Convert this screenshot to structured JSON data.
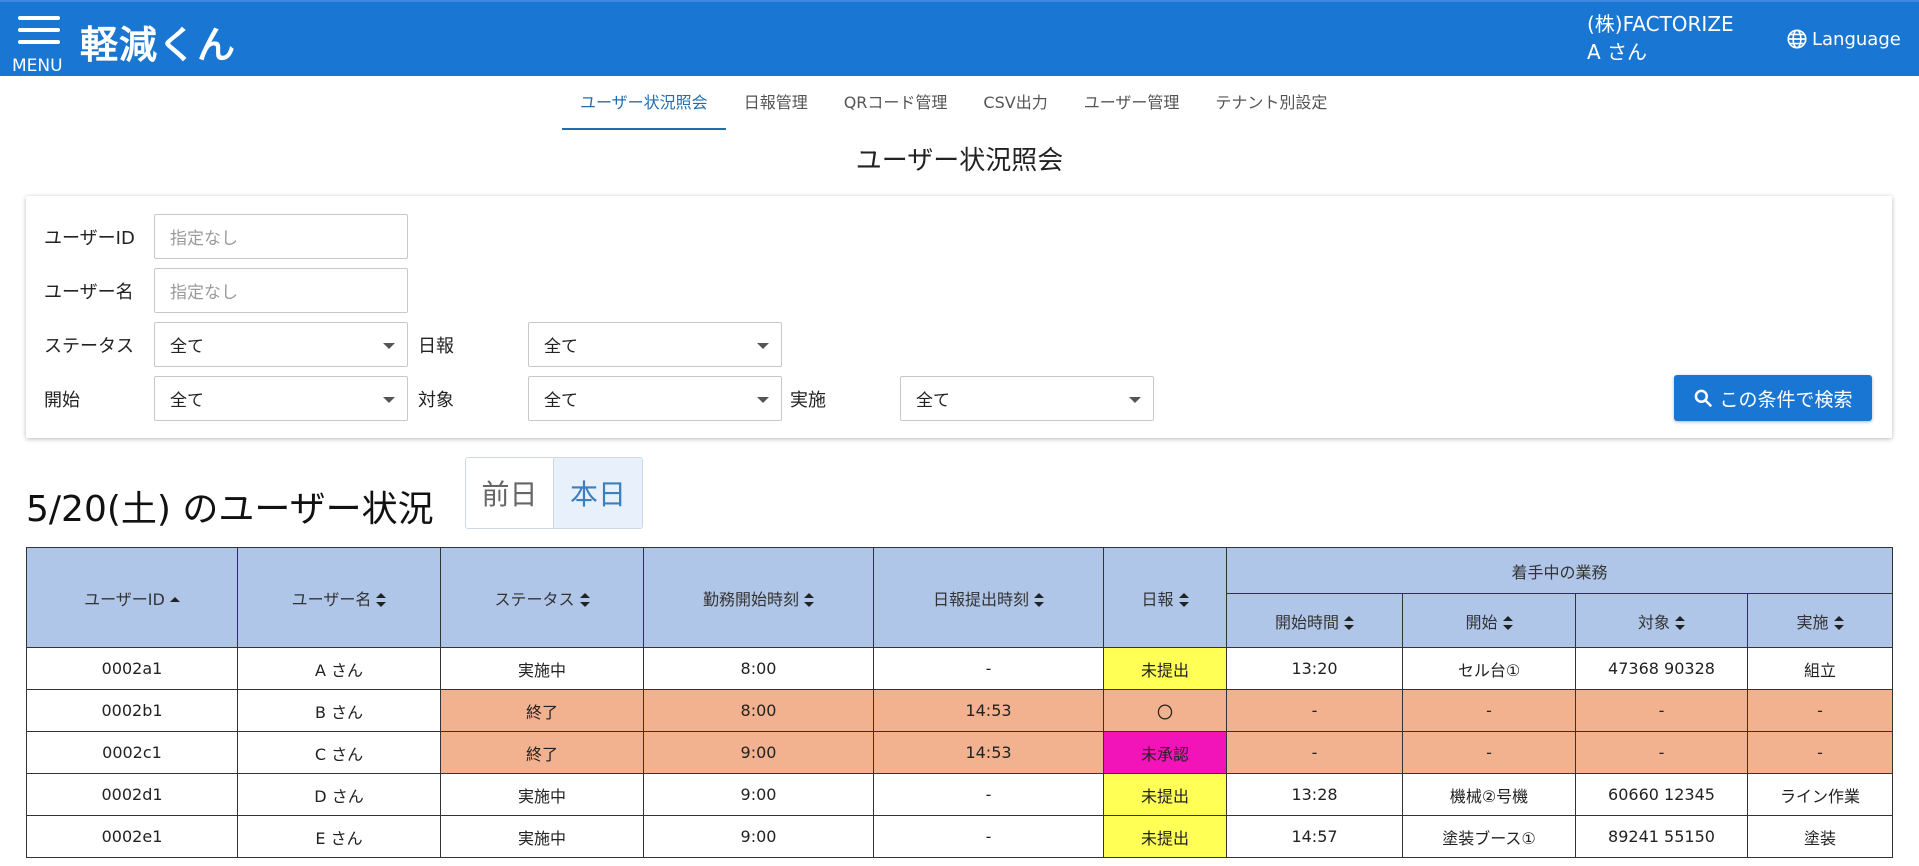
{
  "header": {
    "menu_label": "MENU",
    "app_title": "軽減くん",
    "company": "(株)FACTORIZE",
    "user": "A さん",
    "language_label": "Language"
  },
  "tabs": [
    {
      "label": "ユーザー状況照会",
      "active": true
    },
    {
      "label": "日報管理",
      "active": false
    },
    {
      "label": "QRコード管理",
      "active": false
    },
    {
      "label": "CSV出力",
      "active": false
    },
    {
      "label": "ユーザー管理",
      "active": false
    },
    {
      "label": "テナント別設定",
      "active": false
    }
  ],
  "page_title": "ユーザー状況照会",
  "filters": {
    "user_id": {
      "label": "ユーザーID",
      "placeholder": "指定なし"
    },
    "user_name": {
      "label": "ユーザー名",
      "placeholder": "指定なし"
    },
    "status": {
      "label": "ステータス",
      "value": "全て"
    },
    "report": {
      "label": "日報",
      "value": "全て"
    },
    "start": {
      "label": "開始",
      "value": "全て"
    },
    "target": {
      "label": "対象",
      "value": "全て"
    },
    "execution": {
      "label": "実施",
      "value": "全て"
    },
    "search_button": "この条件で検索"
  },
  "status_heading": "5/20(土) のユーザー状況",
  "day_toggle": {
    "prev": "前日",
    "today": "本日"
  },
  "table": {
    "headers": {
      "user_id": "ユーザーID",
      "user_name": "ユーザー名",
      "status": "ステータス",
      "work_start": "勤務開始時刻",
      "report_time": "日報提出時刻",
      "report": "日報",
      "current_task": "着手中の業務",
      "task_start_time": "開始時間",
      "task_start": "開始",
      "task_target": "対象",
      "task_exec": "実施"
    },
    "rows": [
      {
        "id": "0002a1",
        "name": "A さん",
        "status": "実施中",
        "work_start": "8:00",
        "report_time": "-",
        "report": "未提出",
        "t_time": "13:20",
        "t_start": "セル台①",
        "t_target": "47368 90328",
        "t_exec": "組立"
      },
      {
        "id": "0002b1",
        "name": "B さん",
        "status": "終了",
        "work_start": "8:00",
        "report_time": "14:53",
        "report": "〇",
        "t_time": "-",
        "t_start": "-",
        "t_target": "-",
        "t_exec": "-"
      },
      {
        "id": "0002c1",
        "name": "C さん",
        "status": "終了",
        "work_start": "9:00",
        "report_time": "14:53",
        "report": "未承認",
        "t_time": "-",
        "t_start": "-",
        "t_target": "-",
        "t_exec": "-"
      },
      {
        "id": "0002d1",
        "name": "D さん",
        "status": "実施中",
        "work_start": "9:00",
        "report_time": "-",
        "report": "未提出",
        "t_time": "13:28",
        "t_start": "機械②号機",
        "t_target": "60660 12345",
        "t_exec": "ライン作業"
      },
      {
        "id": "0002e1",
        "name": "E さん",
        "status": "実施中",
        "work_start": "9:00",
        "report_time": "-",
        "report": "未提出",
        "t_time": "14:57",
        "t_start": "塗装ブース①",
        "t_target": "89241 55150",
        "t_exec": "塗装"
      }
    ]
  },
  "colors": {
    "appbar": "#1976d2",
    "header_cell": "#b0c6e8",
    "done_row": "#f2b28f",
    "not_submitted": "#ffff55",
    "not_approved": "#f214b8"
  },
  "icons": [
    "menu-icon",
    "globe-icon",
    "search-icon",
    "sort-icon",
    "sort-asc-icon",
    "dropdown-caret-icon"
  ]
}
